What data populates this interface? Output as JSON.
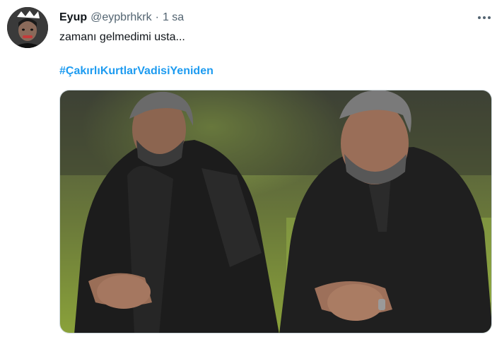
{
  "tweet": {
    "author_name": "Eyup",
    "author_handle": "@eypbrhkrk",
    "separator": "·",
    "time": "1 sa",
    "text": "zamanı gelmedimi usta...",
    "hashtag": "#ÇakırlıKurtlarVadisiYeniden",
    "more_icon": "more-horizontal-icon",
    "avatar_icon": "profile-avatar"
  },
  "colors": {
    "text_primary": "#0f1419",
    "text_secondary": "#536471",
    "link": "#1d9bf0",
    "border": "#cfd9de"
  }
}
